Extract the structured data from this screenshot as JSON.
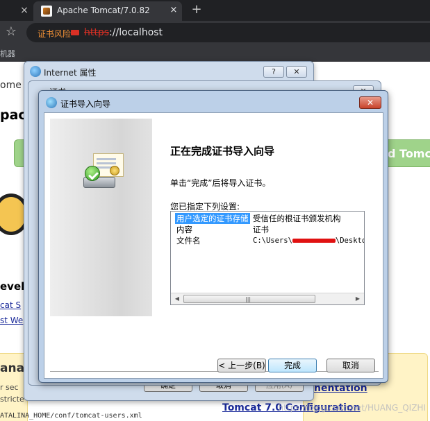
{
  "browser": {
    "inactive_tab_close": "×",
    "tab_title": "Apache Tomcat/7.0.82",
    "tab_close": "×",
    "new_tab": "+",
    "star": "☆",
    "cert_warning": "证书风险",
    "url_scheme": "https",
    "url_rest": "://localhost",
    "bookmark": "机器"
  },
  "background_page": {
    "home": "ome",
    "apache": "pacl",
    "tomcat_banner": "d Tomc",
    "developer": "evelo",
    "link1": "cat S",
    "link2": "st We",
    "manager": "ana",
    "security_text1": "r sec",
    "security_text2": "stricte",
    "security_text3": "ATALINA_HOME/conf/tomcat-users.xml",
    "documentation_link": "nentation",
    "config_link": "Tomcat 7.0 Configuration",
    "watermark": "https://blog.csdn.net/HUANG_QIZHI"
  },
  "internet_properties": {
    "title": "Internet 属性",
    "help_button": "?",
    "close_button": "✕",
    "ok_button": "确定",
    "cancel_button": "取消",
    "apply_button": "应用(A)"
  },
  "certificate_window": {
    "title": "证书",
    "close_button": "✕"
  },
  "wizard": {
    "title": "证书导入向导",
    "close_button": "✕",
    "heading": "正在完成证书导入向导",
    "description": "单击“完成”后将导入证书。",
    "settings_label": "您已指定下列设置:",
    "settings": [
      {
        "key": "用户选定的证书存储",
        "value": "受信任的根证书颁发机构"
      },
      {
        "key": "内容",
        "value": "证书"
      },
      {
        "key": "文件名",
        "value_prefix": "C:\\Users\\",
        "value_suffix": "\\Desktop"
      }
    ],
    "scroll_left": "◀",
    "scroll_grip": "|||",
    "scroll_right": "▶",
    "back_button": "< 上一步(B)",
    "finish_button": "完成",
    "cancel_button": "取消"
  }
}
